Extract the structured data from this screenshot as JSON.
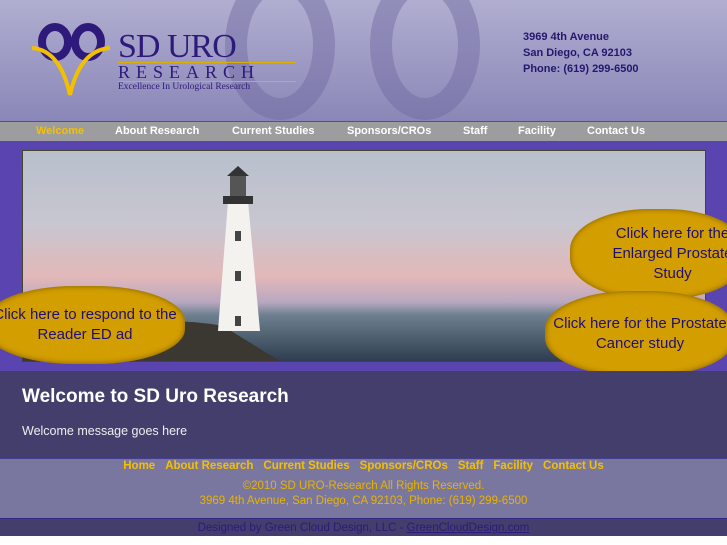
{
  "logo": {
    "title": "SD URO",
    "subtitle": "RESEARCH",
    "tagline": "Excellence In Urological Research"
  },
  "address": {
    "line1": "3969 4th Avenue",
    "line2": "San Diego, CA 92103",
    "phone": "Phone: (619) 299-6500"
  },
  "nav": [
    "Welcome",
    "About Research",
    "Current Studies",
    "Sponsors/CROs",
    "Staff",
    "Facility",
    "Contact Us"
  ],
  "bubbles": {
    "reader_ed": "Click here to respond to the Reader ED ad",
    "enlarged_prostate": "Click here for the Enlarged Prostate Study",
    "prostate_cancer": "Click here for the Prostate Cancer study"
  },
  "welcome": {
    "title": "Welcome to SD Uro Research",
    "message": "Welcome message goes here"
  },
  "footer": {
    "nav": [
      "Home",
      "About Research",
      "Current Studies",
      "Sponsors/CROs",
      "Staff",
      "Facility",
      "Contact Us"
    ],
    "copyright": "©2010 SD URO-Research All Rights Reserved.",
    "address": "3969 4th Avenue, San Diego, CA 92103, Phone: (619) 299-6500",
    "credit_text": "Designed by Green Cloud Design, LLC - ",
    "credit_link": "GreenCloudDesign.com"
  }
}
